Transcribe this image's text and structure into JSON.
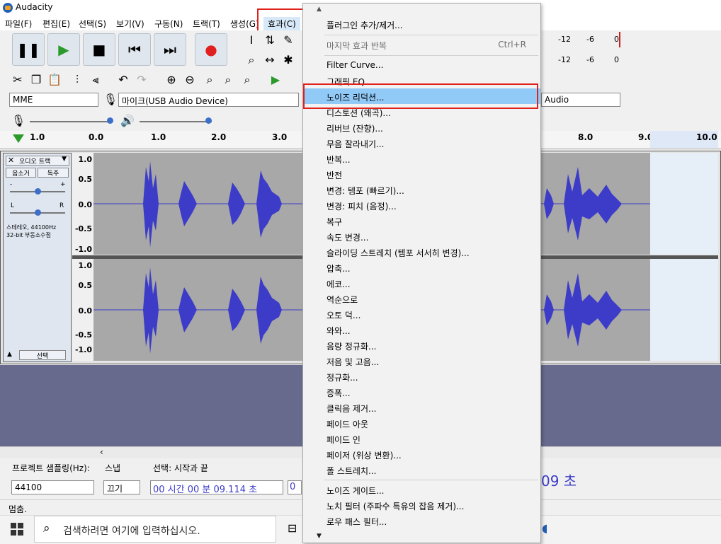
{
  "window": {
    "title": "Audacity"
  },
  "menubar": {
    "items": [
      {
        "label": "파일(F)"
      },
      {
        "label": "편집(E)"
      },
      {
        "label": "선택(S)"
      },
      {
        "label": "보기(V)"
      },
      {
        "label": "구동(N)"
      },
      {
        "label": "트랙(T)"
      },
      {
        "label": "생성(G)"
      },
      {
        "label": "효과(C)"
      }
    ]
  },
  "devices": {
    "host": "MME",
    "input": "마이크(USB Audio Device)",
    "output": "Audio"
  },
  "ruler": {
    "ticks": [
      {
        "label": "1.0"
      },
      {
        "label": "0.0"
      },
      {
        "label": "1.0"
      },
      {
        "label": "2.0"
      },
      {
        "label": "3.0"
      },
      {
        "label": "8.0"
      },
      {
        "label": "9.0"
      },
      {
        "label": "10.0"
      }
    ]
  },
  "meters": {
    "ticks_top": [
      "-12",
      "-6",
      "0"
    ],
    "ticks_bottom": [
      "-12",
      "-6",
      "0"
    ]
  },
  "track": {
    "name": "오디오 트랙",
    "mute": "음소거",
    "solo": "독주",
    "info_line1": "스테레오, 44100Hz",
    "info_line2": "32-bit 부동소수점",
    "select": "선택",
    "gain_minus": "-",
    "gain_plus": "+",
    "pan_l": "L",
    "pan_r": "R",
    "yscale": [
      "1.0",
      "0.5",
      "0.0",
      "-0.5",
      "-1.0"
    ]
  },
  "bottom": {
    "rate_label": "프로젝트 샘플링(Hz):",
    "snap_label": "스냅",
    "selection_label": "선택: 시작과 끝",
    "rate_value": "44100",
    "snap_value": "끄기",
    "time_value": "00 시간 00 분 09.114 초",
    "time_value2": "0",
    "right_time": "09 초"
  },
  "status": {
    "text": "멈춤."
  },
  "taskbar": {
    "search_placeholder": "검색하려면 여기에 입력하십시오."
  },
  "effects_menu": {
    "items": [
      {
        "label": "플러그인 추가/제거...",
        "shortcut": "",
        "disabled": false,
        "selected": false
      },
      {
        "label": "마지막 효과 반복",
        "shortcut": "Ctrl+R",
        "disabled": true,
        "selected": false
      },
      {
        "label": "Filter Curve...",
        "shortcut": "",
        "disabled": false,
        "selected": false
      },
      {
        "label": "그래픽 EQ...",
        "shortcut": "",
        "disabled": false,
        "selected": false
      },
      {
        "label": "노이즈 리덕션...",
        "shortcut": "",
        "disabled": false,
        "selected": true
      },
      {
        "label": "디스토션 (왜곡)...",
        "shortcut": "",
        "disabled": false,
        "selected": false
      },
      {
        "label": "리버브 (잔향)...",
        "shortcut": "",
        "disabled": false,
        "selected": false
      },
      {
        "label": "무음 잘라내기...",
        "shortcut": "",
        "disabled": false,
        "selected": false
      },
      {
        "label": "반복...",
        "shortcut": "",
        "disabled": false,
        "selected": false
      },
      {
        "label": "반전",
        "shortcut": "",
        "disabled": false,
        "selected": false
      },
      {
        "label": "변경: 템포 (빠르기)...",
        "shortcut": "",
        "disabled": false,
        "selected": false
      },
      {
        "label": "변경: 피치 (음정)...",
        "shortcut": "",
        "disabled": false,
        "selected": false
      },
      {
        "label": "복구",
        "shortcut": "",
        "disabled": false,
        "selected": false
      },
      {
        "label": "속도 변경...",
        "shortcut": "",
        "disabled": false,
        "selected": false
      },
      {
        "label": "슬라이딩 스트레치 (템포 서서히 변경)...",
        "shortcut": "",
        "disabled": false,
        "selected": false
      },
      {
        "label": "압축...",
        "shortcut": "",
        "disabled": false,
        "selected": false
      },
      {
        "label": "에코...",
        "shortcut": "",
        "disabled": false,
        "selected": false
      },
      {
        "label": "역순으로",
        "shortcut": "",
        "disabled": false,
        "selected": false
      },
      {
        "label": "오토 덕...",
        "shortcut": "",
        "disabled": false,
        "selected": false
      },
      {
        "label": "와와...",
        "shortcut": "",
        "disabled": false,
        "selected": false
      },
      {
        "label": "음량 정규화...",
        "shortcut": "",
        "disabled": false,
        "selected": false
      },
      {
        "label": "저음 및 고음...",
        "shortcut": "",
        "disabled": false,
        "selected": false
      },
      {
        "label": "정규화...",
        "shortcut": "",
        "disabled": false,
        "selected": false
      },
      {
        "label": "증폭...",
        "shortcut": "",
        "disabled": false,
        "selected": false
      },
      {
        "label": "클릭음 제거...",
        "shortcut": "",
        "disabled": false,
        "selected": false
      },
      {
        "label": "페이드 아웃",
        "shortcut": "",
        "disabled": false,
        "selected": false
      },
      {
        "label": "페이드 인",
        "shortcut": "",
        "disabled": false,
        "selected": false
      },
      {
        "label": "페이저 (위상 변환)...",
        "shortcut": "",
        "disabled": false,
        "selected": false
      },
      {
        "label": "폴 스트레치...",
        "shortcut": "",
        "disabled": false,
        "selected": false
      },
      {
        "label": "노이즈 게이트...",
        "shortcut": "",
        "disabled": false,
        "selected": false
      },
      {
        "label": "노치 필터 (주파수 특유의 잡음 제거)...",
        "shortcut": "",
        "disabled": false,
        "selected": false
      },
      {
        "label": "로우 패스 필터...",
        "shortcut": "",
        "disabled": false,
        "selected": false
      }
    ]
  },
  "colors": {
    "accent": "#91c9f7",
    "highlight_box": "#e0201a",
    "waveform": "#3c3cc8"
  }
}
